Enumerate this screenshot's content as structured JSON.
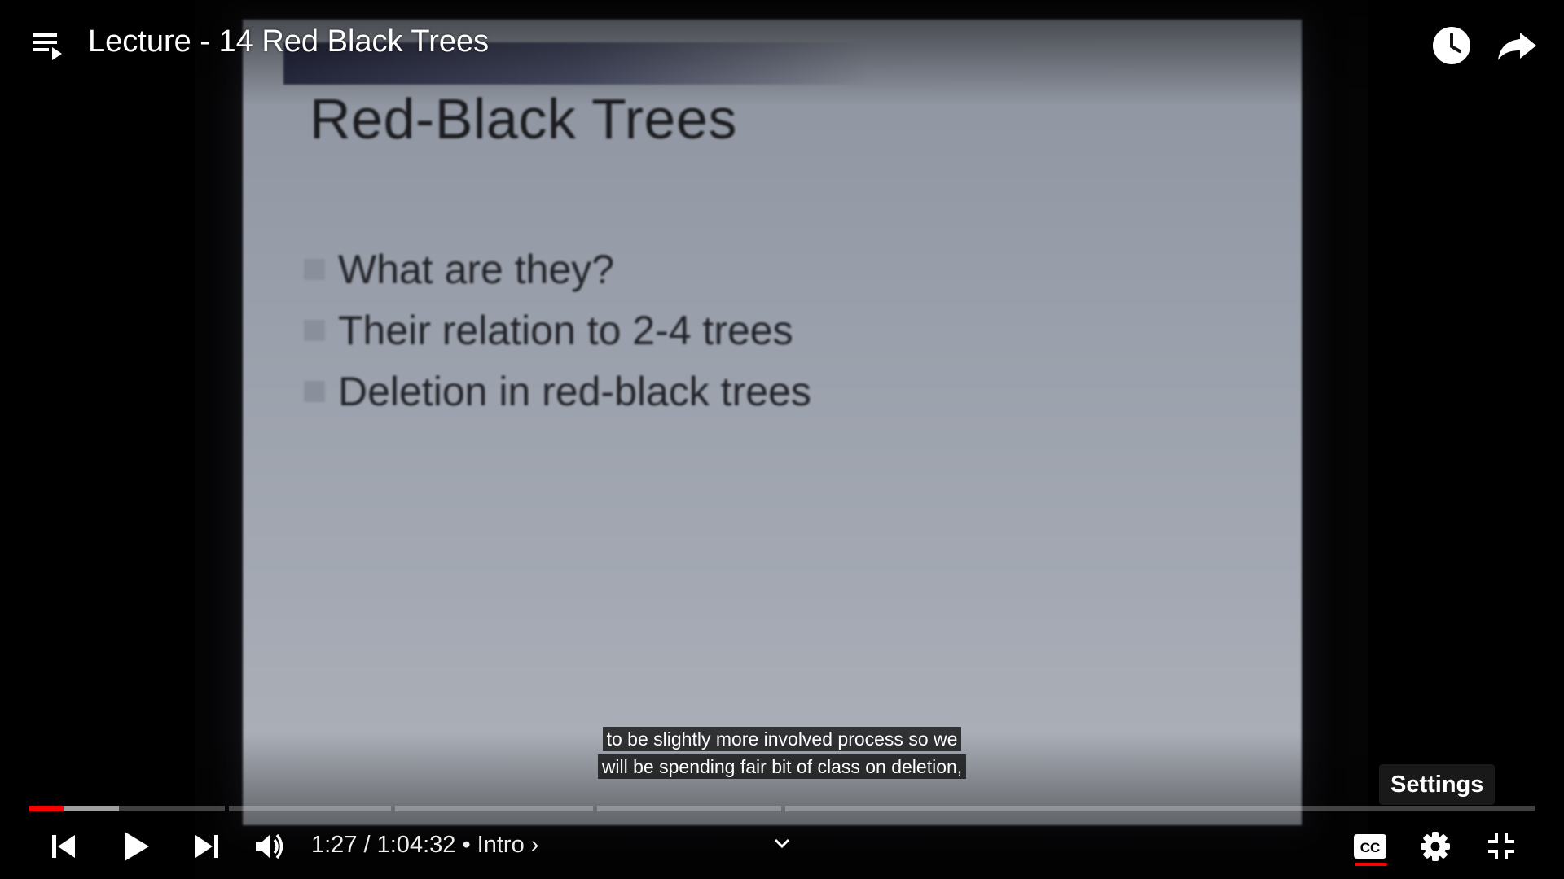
{
  "header": {
    "title": "Lecture - 14 Red Black Trees"
  },
  "icons": {
    "playlist": "playlist-icon",
    "watch_later": "clock-icon",
    "share": "share-icon",
    "prev": "skip-previous-icon",
    "play": "play-icon",
    "next": "skip-next-icon",
    "volume": "volume-icon",
    "chapter_expand": "chevron-down-icon",
    "captions": "cc-icon",
    "settings": "gear-icon",
    "exit_fullscreen": "exit-fullscreen-icon"
  },
  "slide": {
    "title": "Red-Black Trees",
    "bullets": [
      "What are they?",
      "Their relation to 2-4 trees",
      "Deletion in red-black trees"
    ]
  },
  "captions": {
    "line1": "to be slightly more involved process so we",
    "line2": "will be spending fair bit of class on deletion,"
  },
  "tooltip": {
    "text": "Settings"
  },
  "player": {
    "current_time": "1:27",
    "separator": " / ",
    "duration": "1:04:32",
    "chapter_sep": " • ",
    "chapter": "Intro",
    "chapter_arrow": "›",
    "played_fraction": 0.0225,
    "captions_on": true
  },
  "colors": {
    "progress_played": "#ff0000",
    "cc_active": "#ff0000"
  }
}
